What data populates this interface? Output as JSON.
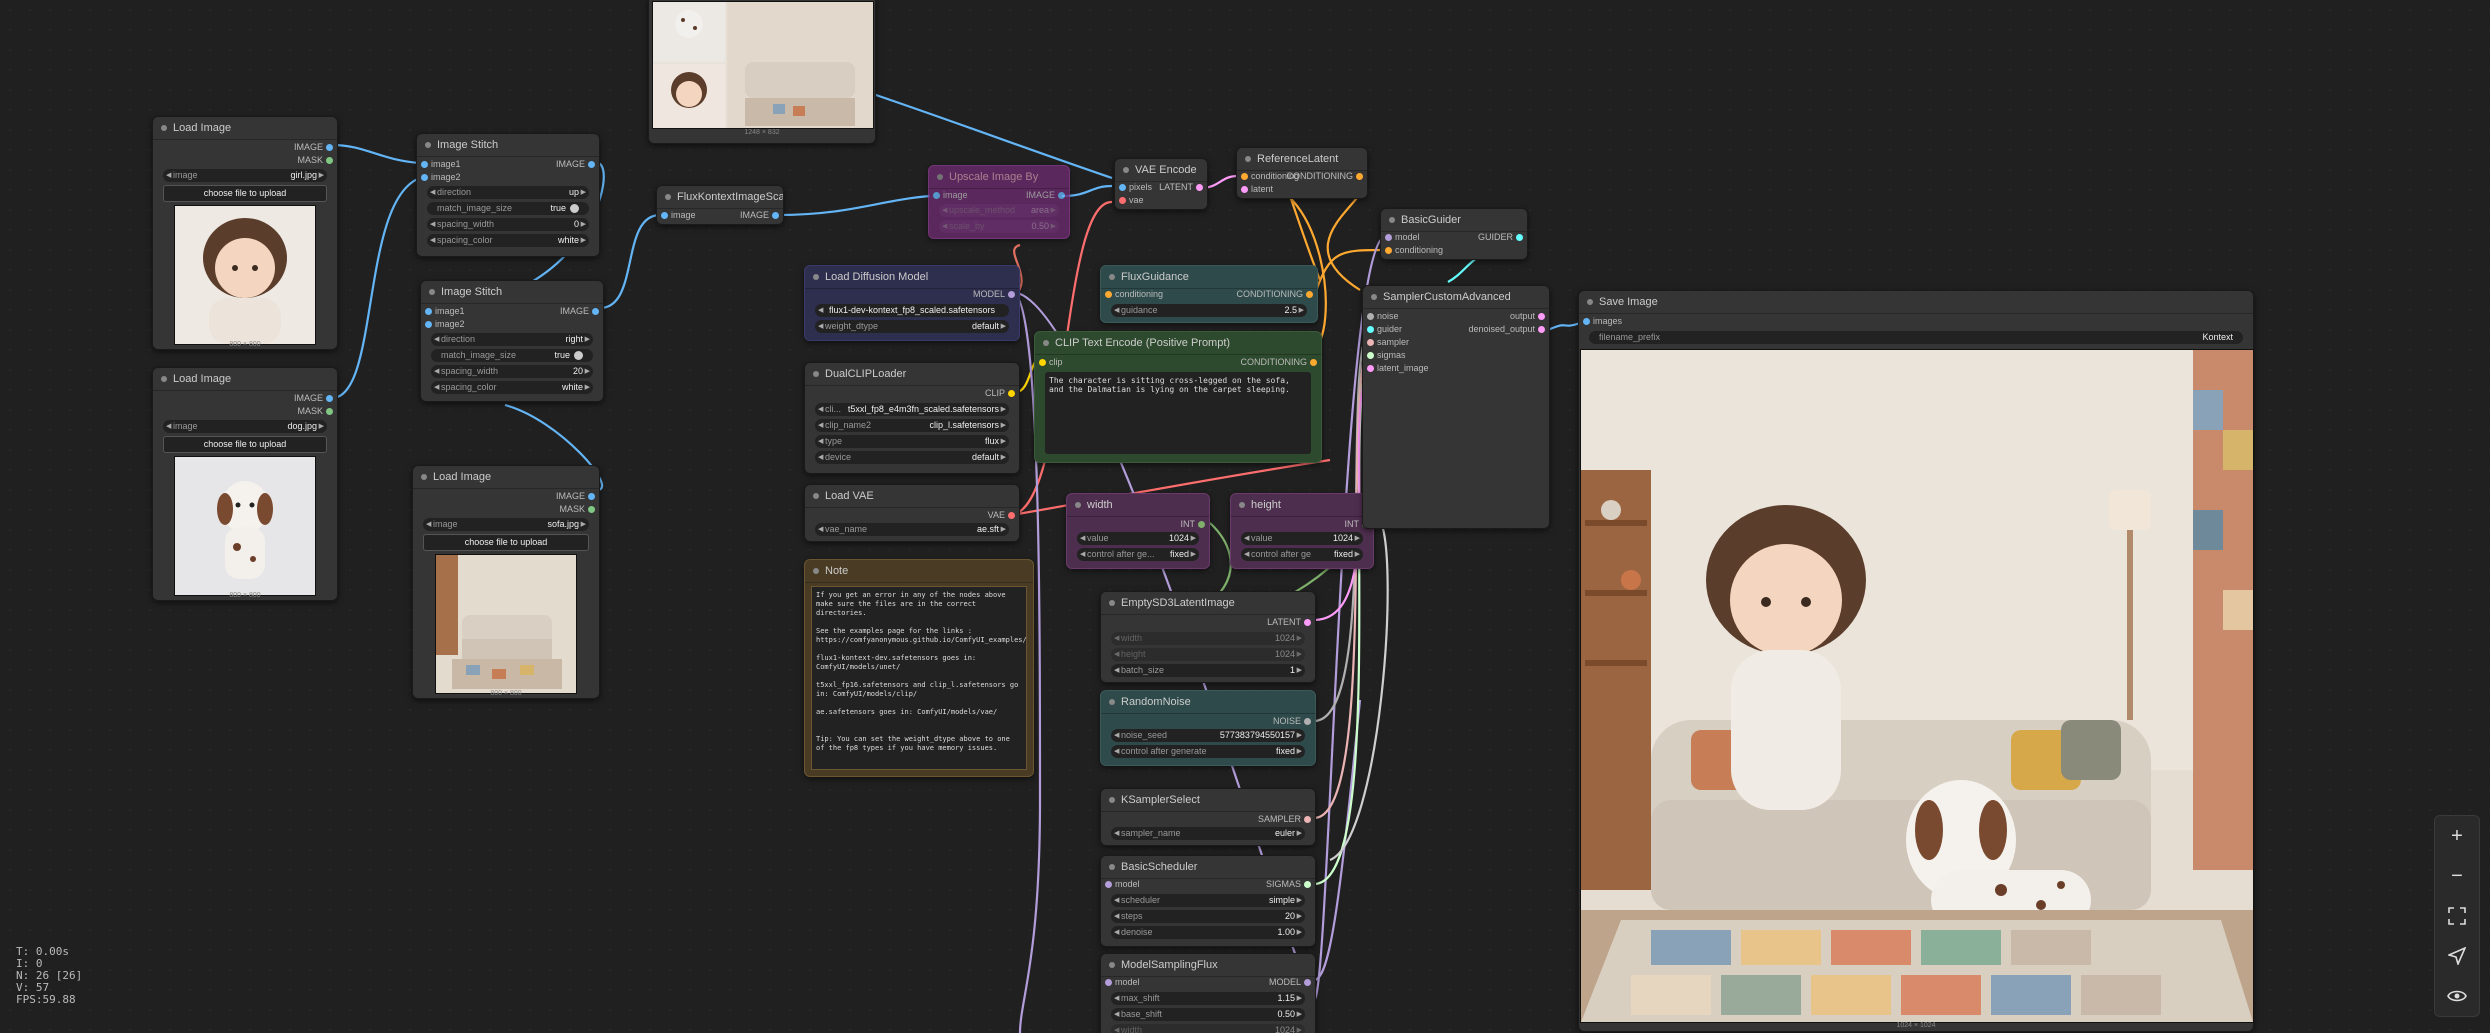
{
  "colors": {
    "image_link": "#64b5f6",
    "model_link": "#b39ddb",
    "conditioning_link": "#ffa931",
    "latent_link": "#ff9cf9",
    "vae_link": "#ff6e6e",
    "clip_link": "#ffd500",
    "noise_link": "#b0b0b0",
    "guider_link": "#66ffff",
    "int_link": "#7fb06b",
    "sigmas_link": "#cdffcd",
    "sampler_link": "#ecb4b4"
  },
  "preview_top": {
    "caption": "1248 × 832"
  },
  "load_image_1": {
    "title": "Load Image",
    "out1": "IMAGE",
    "out2": "MASK",
    "image_label": "image",
    "image_value": "girl.jpg",
    "upload": "choose file to upload",
    "caption": "800 × 800",
    "icon": "girl-photo"
  },
  "load_image_2": {
    "title": "Load Image",
    "out1": "IMAGE",
    "out2": "MASK",
    "image_label": "image",
    "image_value": "dog.jpg",
    "upload": "choose file to upload",
    "caption": "800 × 800",
    "icon": "dog-photo"
  },
  "load_image_3": {
    "title": "Load Image",
    "out1": "IMAGE",
    "out2": "MASK",
    "image_label": "image",
    "image_value": "sofa.jpg",
    "upload": "choose file to upload",
    "caption": "800 × 800",
    "icon": "sofa-photo"
  },
  "stitch_1": {
    "title": "Image Stitch",
    "in1": "image1",
    "in2": "image2",
    "out": "IMAGE",
    "w": [
      {
        "l": "direction",
        "v": "up"
      },
      {
        "l": "match_image_size",
        "v": "true"
      },
      {
        "l": "spacing_width",
        "v": "0"
      },
      {
        "l": "spacing_color",
        "v": "white"
      }
    ]
  },
  "stitch_2": {
    "title": "Image Stitch",
    "in1": "image1",
    "in2": "image2",
    "out": "IMAGE",
    "w": [
      {
        "l": "direction",
        "v": "right"
      },
      {
        "l": "match_image_size",
        "v": "true"
      },
      {
        "l": "spacing_width",
        "v": "20"
      },
      {
        "l": "spacing_color",
        "v": "white"
      }
    ]
  },
  "flux_scale": {
    "title": "FluxKontextImageScale",
    "in": "image",
    "out": "IMAGE"
  },
  "upscale": {
    "title": "Upscale Image By",
    "in": "image",
    "out": "IMAGE",
    "w": [
      {
        "l": "upscale_method",
        "v": "area"
      },
      {
        "l": "scale_by",
        "v": "0.50"
      }
    ]
  },
  "vae_encode": {
    "title": "VAE Encode",
    "in1": "pixels",
    "in2": "vae",
    "out": "LATENT"
  },
  "ref_latent": {
    "title": "ReferenceLatent",
    "in1": "conditioning",
    "in2": "latent",
    "out": "CONDITIONING"
  },
  "basic_guider": {
    "title": "BasicGuider",
    "in1": "model",
    "in2": "conditioning",
    "out": "GUIDER"
  },
  "load_diffusion": {
    "title": "Load Diffusion Model",
    "out": "MODEL",
    "w": [
      {
        "l": "",
        "v": "flux1-dev-kontext_fp8_scaled.safetensors"
      },
      {
        "l": "weight_dtype",
        "v": "default"
      }
    ]
  },
  "flux_guidance": {
    "title": "FluxGuidance",
    "in": "conditioning",
    "out": "CONDITIONING",
    "w": [
      {
        "l": "guidance",
        "v": "2.5"
      }
    ]
  },
  "clip_text": {
    "title": "CLIP Text Encode (Positive Prompt)",
    "in": "clip",
    "out": "CONDITIONING",
    "text": "The character is sitting cross-legged on the sofa, and the Dalmatian is lying on the carpet sleeping."
  },
  "dual_clip": {
    "title": "DualCLIPLoader",
    "out": "CLIP",
    "w": [
      {
        "l": "cli...",
        "v": "t5xxl_fp8_e4m3fn_scaled.safetensors"
      },
      {
        "l": "clip_name2",
        "v": "clip_l.safetensors"
      },
      {
        "l": "type",
        "v": "flux"
      },
      {
        "l": "device",
        "v": "default"
      }
    ]
  },
  "load_vae": {
    "title": "Load VAE",
    "out": "VAE",
    "w": [
      {
        "l": "vae_name",
        "v": "ae.sft"
      }
    ]
  },
  "note": {
    "title": "Note",
    "text": "If you get an error in any of the nodes above make sure the files are in the correct directories.\n\nSee the examples page for the links :\nhttps://comfyanonymous.github.io/ComfyUI_examples/flux/\n\nflux1-kontext-dev.safetensors goes in: ComfyUI/models/unet/\n\nt5xxl_fp16.safetensors and clip_l.safetensors go in: ComfyUI/models/clip/\n\nae.safetensors goes in: ComfyUI/models/vae/\n\n\nTip: You can set the weight_dtype above to one of the fp8 types if you have memory issues."
  },
  "width_node": {
    "title": "width",
    "out": "INT",
    "w": [
      {
        "l": "value",
        "v": "1024"
      },
      {
        "l": "control after ge...",
        "v": "fixed"
      }
    ]
  },
  "height_node": {
    "title": "height",
    "out": "INT",
    "w": [
      {
        "l": "value",
        "v": "1024"
      },
      {
        "l": "control after ge",
        "v": "fixed"
      }
    ]
  },
  "sampler_adv": {
    "title": "SamplerCustomAdvanced",
    "ins": [
      "noise",
      "guider",
      "sampler",
      "sigmas",
      "latent_image"
    ],
    "out1": "output",
    "out2": "denoised_output"
  },
  "save_image": {
    "title": "Save Image",
    "in": "images",
    "prefix_label": "filename_prefix",
    "prefix_value": "Kontext",
    "caption": "1024 × 1024"
  },
  "empty_latent": {
    "title": "EmptySD3LatentImage",
    "out": "LATENT",
    "w": [
      {
        "l": "width",
        "v": "1024"
      },
      {
        "l": "height",
        "v": "1024"
      },
      {
        "l": "batch_size",
        "v": "1"
      }
    ]
  },
  "random_noise": {
    "title": "RandomNoise",
    "out": "NOISE",
    "w": [
      {
        "l": "noise_seed",
        "v": "577383794550157"
      },
      {
        "l": "control after generate",
        "v": "fixed"
      }
    ]
  },
  "ksampler_select": {
    "title": "KSamplerSelect",
    "out": "SAMPLER",
    "w": [
      {
        "l": "sampler_name",
        "v": "euler"
      }
    ]
  },
  "basic_scheduler": {
    "title": "BasicScheduler",
    "in": "model",
    "out": "SIGMAS",
    "w": [
      {
        "l": "scheduler",
        "v": "simple"
      },
      {
        "l": "steps",
        "v": "20"
      },
      {
        "l": "denoise",
        "v": "1.00"
      }
    ]
  },
  "model_sampling": {
    "title": "ModelSamplingFlux",
    "in": "model",
    "out": "MODEL",
    "w": [
      {
        "l": "max_shift",
        "v": "1.15"
      },
      {
        "l": "base_shift",
        "v": "0.50"
      },
      {
        "l": "width",
        "v": "1024"
      }
    ]
  },
  "right_toolbar": {
    "icons": [
      "plus-icon",
      "minus-icon",
      "fit-view-icon",
      "pointer-icon",
      "eye-icon"
    ]
  },
  "stats": {
    "t": "T: 0.00s",
    "i": "I: 0",
    "n": "N: 26 [26]",
    "v": "V: 57",
    "fps": "FPS:59.88"
  }
}
